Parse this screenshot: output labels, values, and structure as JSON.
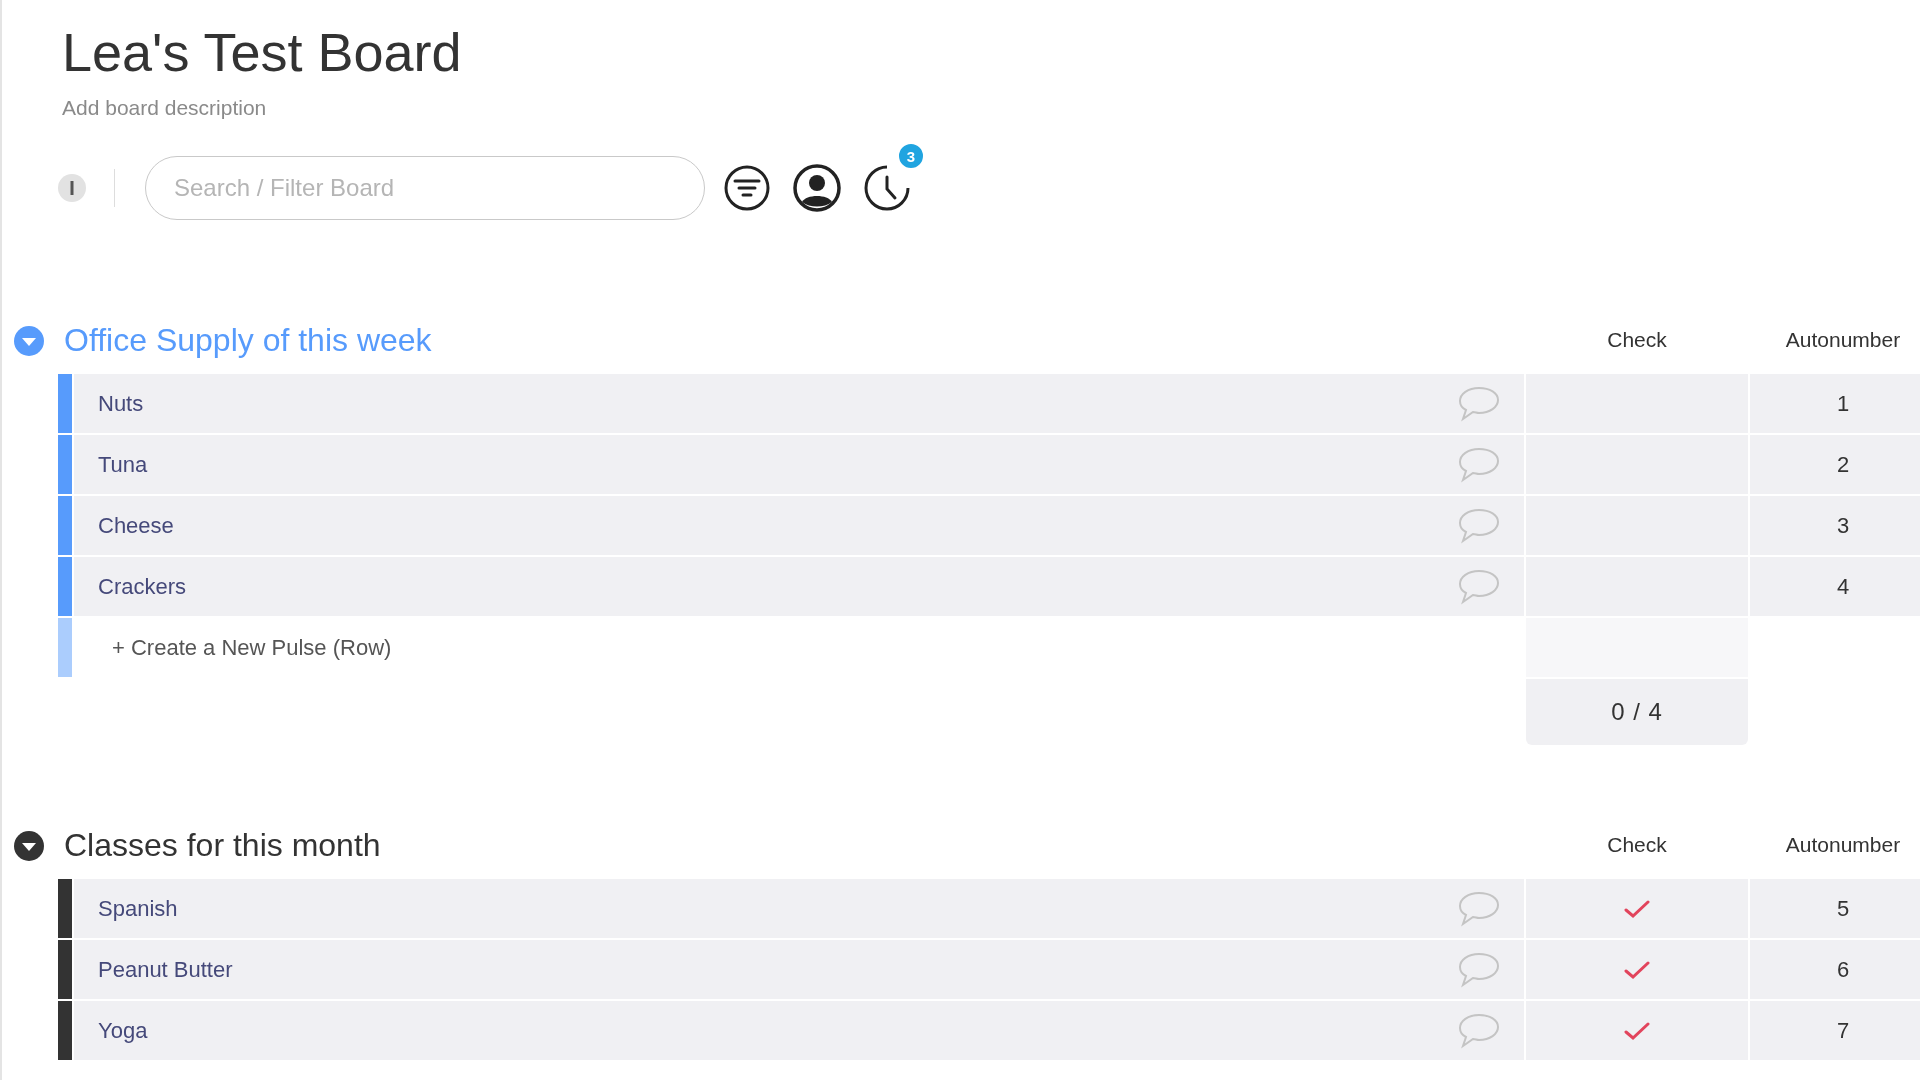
{
  "board": {
    "title": "Lea's Test Board",
    "description": "Add board description"
  },
  "toolbar": {
    "search": {
      "placeholder": "Search / Filter Board"
    },
    "activity_badge": "3"
  },
  "groups": [
    {
      "title": "Office Supply of this week",
      "color": "#579bfc",
      "columns": [
        "Check",
        "Autonumber"
      ],
      "rows": [
        {
          "name": "Nuts",
          "checked": false,
          "number": "1"
        },
        {
          "name": "Tuna",
          "checked": false,
          "number": "2"
        },
        {
          "name": "Cheese",
          "checked": false,
          "number": "3"
        },
        {
          "name": "Crackers",
          "checked": false,
          "number": "4"
        }
      ],
      "new_row": "+ Create a New Pulse (Row)",
      "summary": "0 / 4"
    },
    {
      "title": "Classes for this month",
      "color": "#333333",
      "columns": [
        "Check",
        "Autonumber"
      ],
      "rows": [
        {
          "name": "Spanish",
          "checked": true,
          "number": "5"
        },
        {
          "name": "Peanut Butter",
          "checked": true,
          "number": "6"
        },
        {
          "name": "Yoga",
          "checked": true,
          "number": "7"
        }
      ]
    }
  ]
}
